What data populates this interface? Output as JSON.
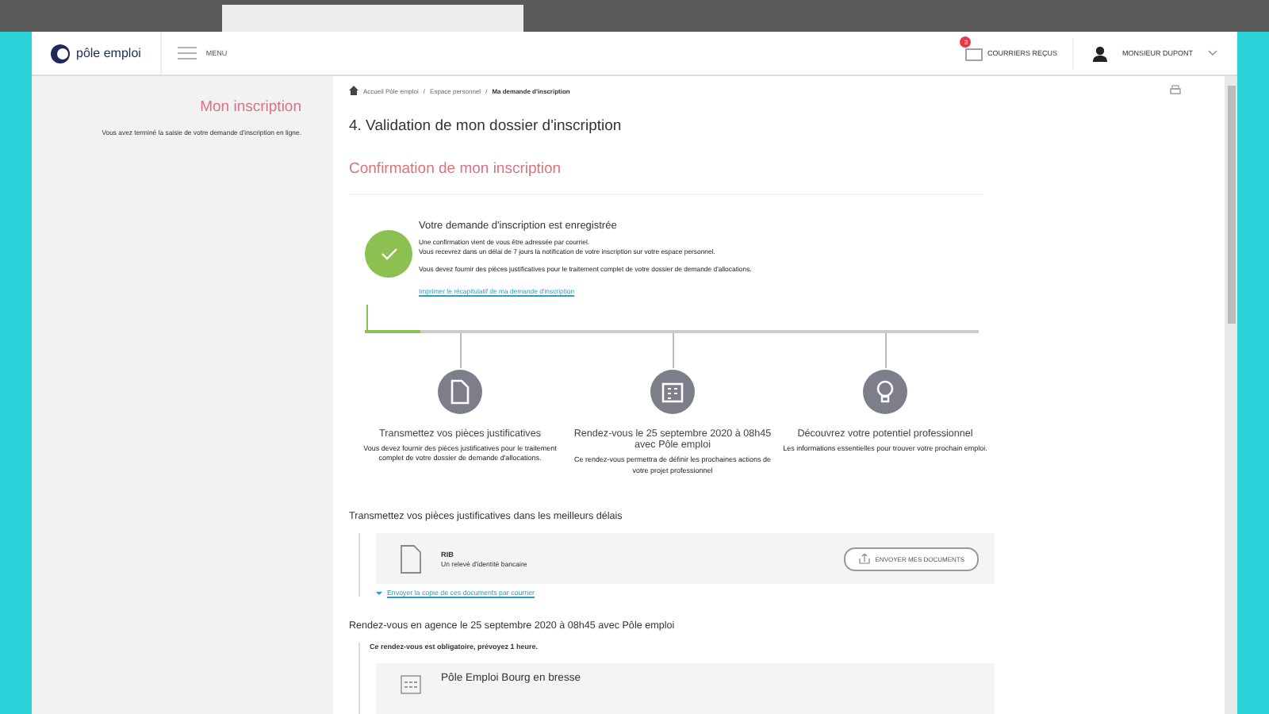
{
  "header": {
    "logo_text": "pôle emploi",
    "menu_label": "MENU",
    "mail": {
      "label": "COURRIERS REÇUS",
      "badge": "3"
    },
    "user": {
      "name": "MONSIEUR DUPONT"
    }
  },
  "sidebar": {
    "title": "Mon inscription",
    "text": "Vous avez terminé la saisie de votre demande d'inscription en ligne."
  },
  "breadcrumb": [
    {
      "label": "Accueil Pôle emploi",
      "current": false,
      "separator": "/"
    },
    {
      "label": "Espace personnel",
      "current": false,
      "separator": "/"
    },
    {
      "label": "Ma demande d'inscription",
      "current": true
    }
  ],
  "page_title": "4. Validation de mon dossier d'inscription",
  "section_title": "Confirmation de mon inscription",
  "confirmation": {
    "title": "Votre demande d'inscription est enregistrée",
    "lines": [
      "Une confirmation vient de vous être adressée par courriel.",
      "Vous recevrez dans un délai de 7 jours la notification de votre inscription sur votre espace personnel."
    ],
    "note": "Vous devez fournir des pièces justificatives pour le traitement complet de votre dossier de demande d'allocations.",
    "link": "Imprimer le récapitulatif de ma demande d'inscription"
  },
  "progress": {
    "level": 0.09
  },
  "steps": [
    {
      "kind": "document",
      "title": "Transmettez vos pièces justificatives",
      "text": "Vous devez fournir des pièces justificatives pour le traitement complet de votre dossier de demande d'allocations."
    },
    {
      "kind": "calendar",
      "title": "Rendez-vous le 25 septembre 2020 à 08h45 avec Pôle emploi",
      "text": "Ce rendez-vous permettra de définir les prochaines actions de votre projet professionnel"
    },
    {
      "kind": "bulb",
      "title": "Découvrez votre potentiel professionnel",
      "text": "Les informations essentielles pour trouver votre prochain emploi."
    }
  ],
  "documents": {
    "heading": "Transmettez vos pièces justificatives dans les meilleurs délais",
    "items": [
      {
        "name": "RIB",
        "description": "Un relevé d'identité bancaire",
        "button": "ENVOYER MES DOCUMENTS"
      }
    ],
    "mail_link": "Envoyer la copie de ces documents par courrier"
  },
  "appointment": {
    "heading": "Rendez-vous en agence le 25 septembre 2020 à 08h45 avec Pôle emploi",
    "note": "Ce rendez-vous est obligatoire, prévoyez 1 heure.",
    "agency": "Pôle Emploi Bourg en bresse"
  }
}
